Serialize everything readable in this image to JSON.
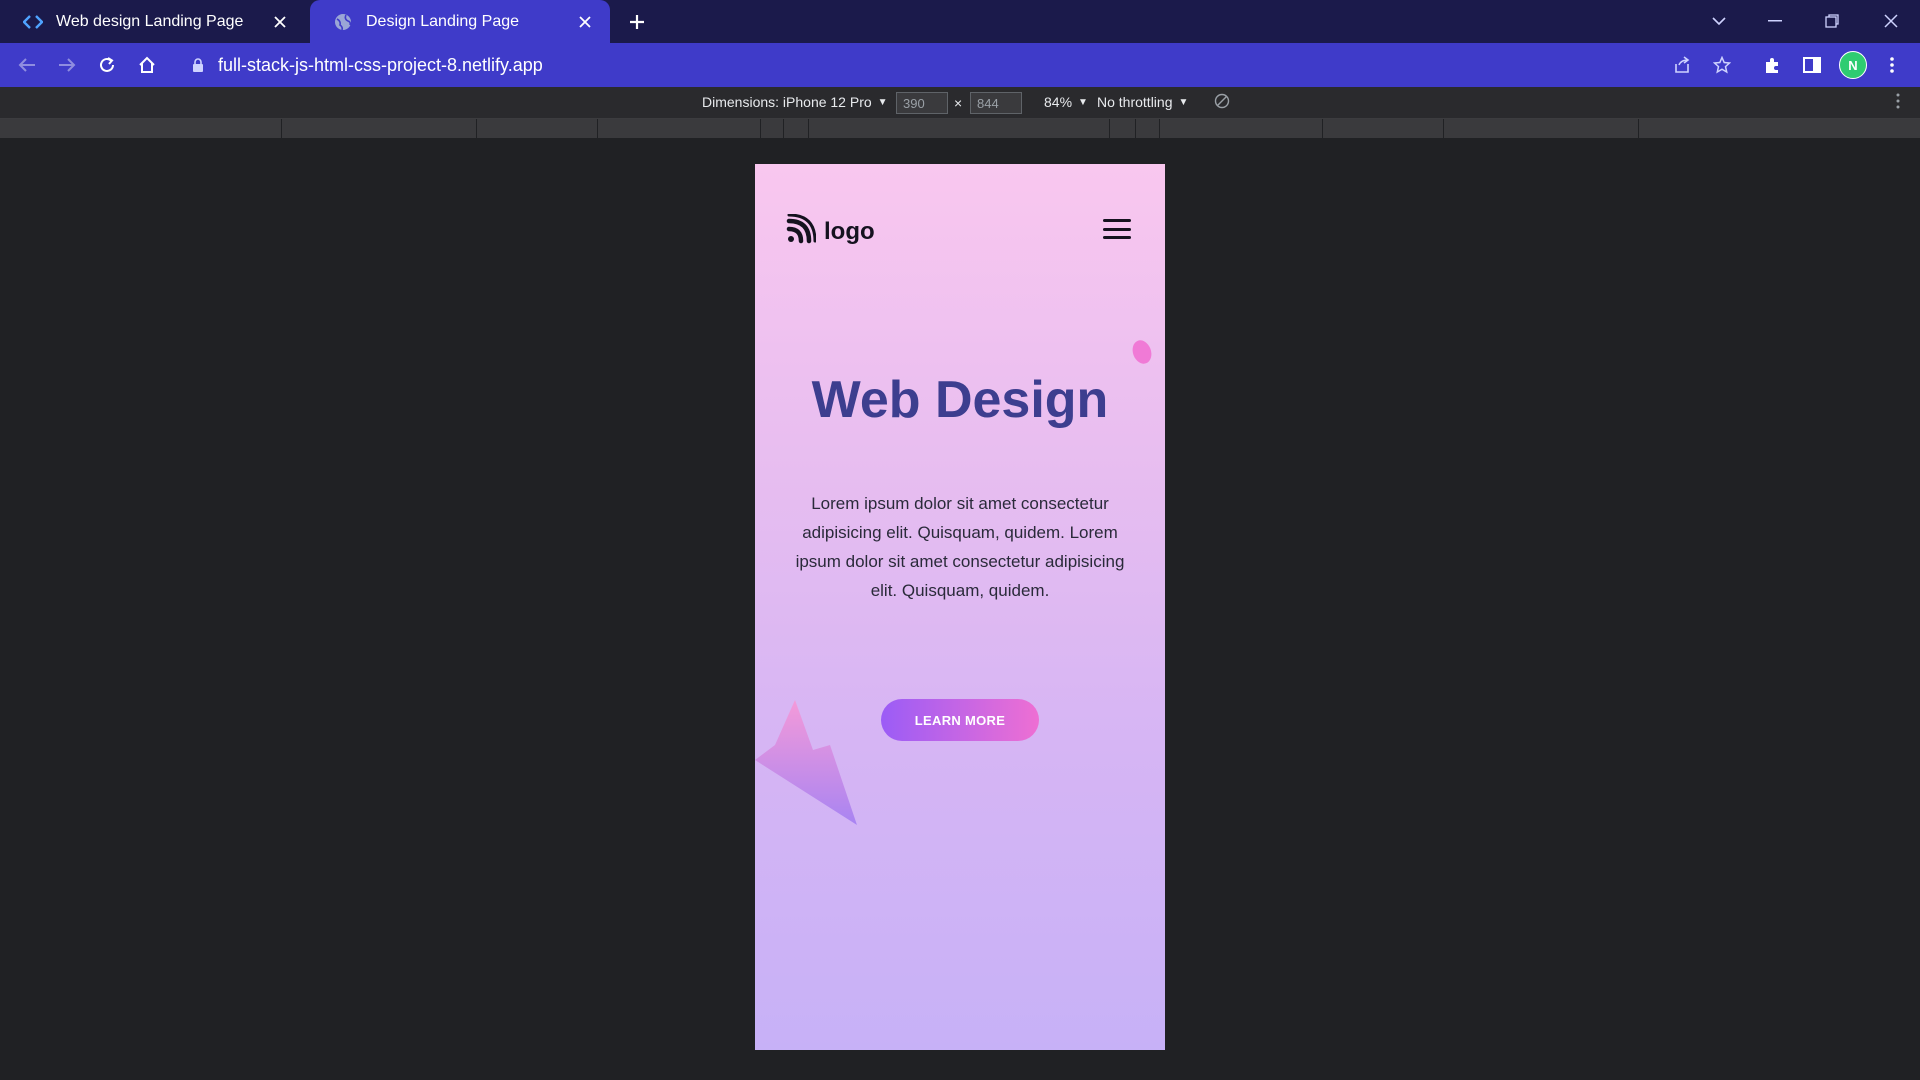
{
  "browser": {
    "tabs": [
      {
        "title": "Web design Landing Page",
        "icon": "code-icon",
        "active": false
      },
      {
        "title": "Design Landing Page",
        "icon": "globe-icon",
        "active": true
      }
    ],
    "url": "full-stack-js-html-css-project-8.netlify.app",
    "avatar_letter": "N"
  },
  "devtools": {
    "dimensions_label": "Dimensions: iPhone 12 Pro",
    "width": "390",
    "height": "844",
    "times": "×",
    "zoom": "84%",
    "throttling": "No throttling"
  },
  "site": {
    "logo_text": "logo",
    "hero_title": "Web Design",
    "hero_text": "Lorem ipsum dolor sit amet consectetur adipisicing elit. Quisquam, quidem. Lorem ipsum dolor sit amet consectetur adipisicing elit. Quisquam, quidem.",
    "cta_label": "LEARN MORE"
  },
  "colors": {
    "tab_strip": "#1b1a4b",
    "toolbar": "#3f3bc9",
    "devtools_bg": "#202124",
    "hero_title": "#3d3e8f",
    "cta_start": "#9b5cf6",
    "cta_end": "#ee6fd3"
  }
}
